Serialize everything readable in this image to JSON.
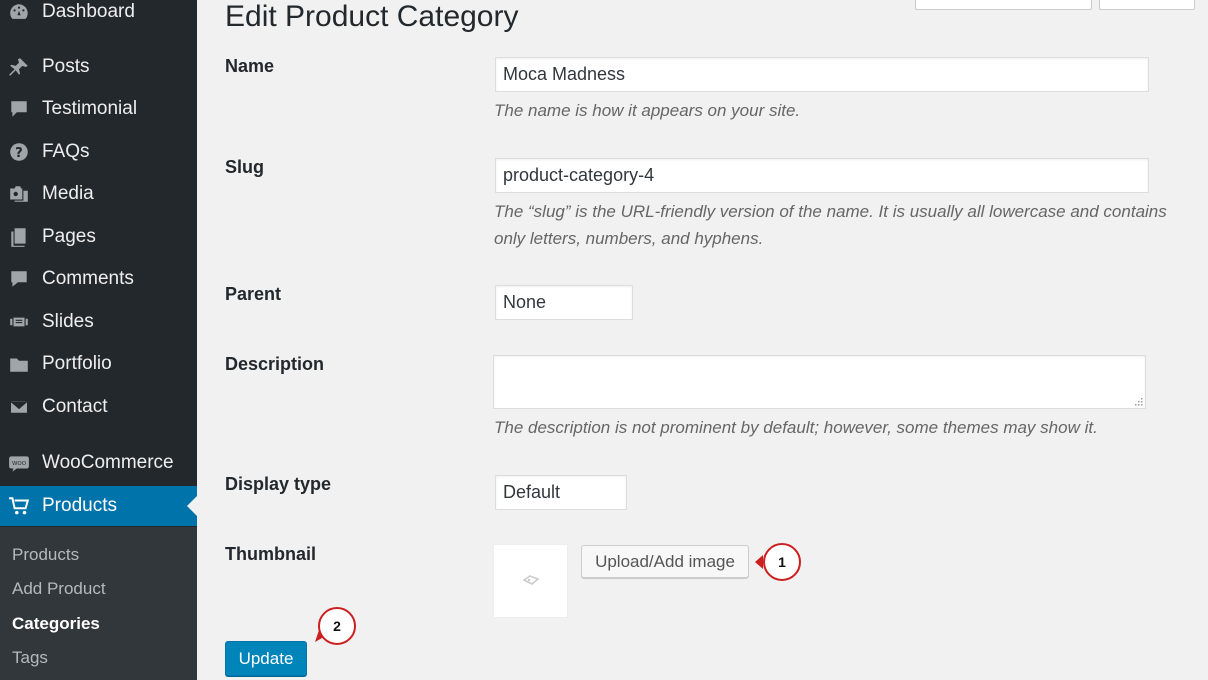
{
  "sidebar": {
    "items": [
      {
        "label": "Dashboard",
        "icon": "dashboard-icon"
      },
      {
        "label": "Posts",
        "icon": "pin-icon"
      },
      {
        "label": "Testimonial",
        "icon": "comment-list-icon"
      },
      {
        "label": "FAQs",
        "icon": "question-icon"
      },
      {
        "label": "Media",
        "icon": "media-icon"
      },
      {
        "label": "Pages",
        "icon": "pages-icon"
      },
      {
        "label": "Comments",
        "icon": "comment-icon"
      },
      {
        "label": "Slides",
        "icon": "slides-icon"
      },
      {
        "label": "Portfolio",
        "icon": "folder-icon"
      },
      {
        "label": "Contact",
        "icon": "envelope-icon"
      },
      {
        "label": "WooCommerce",
        "icon": "woo-icon"
      },
      {
        "label": "Products",
        "icon": "cart-icon"
      }
    ],
    "submenu": [
      "Products",
      "Add Product",
      "Categories",
      "Tags"
    ],
    "current_submenu": "Categories"
  },
  "page": {
    "title": "Edit Product Category"
  },
  "form": {
    "name": {
      "label": "Name",
      "value": "Moca Madness",
      "description": "The name is how it appears on your site."
    },
    "slug": {
      "label": "Slug",
      "value": "product-category-4",
      "description_line1": "The “slug” is the URL-friendly version of the name. It is usually all lowercase and contains",
      "description_line2": "only letters, numbers, and hyphens."
    },
    "parent": {
      "label": "Parent",
      "value": "None"
    },
    "description": {
      "label": "Description",
      "value": "",
      "description": "The description is not prominent by default; however, some themes may show it."
    },
    "display_type": {
      "label": "Display type",
      "value": "Default"
    },
    "thumbnail": {
      "label": "Thumbnail",
      "upload_label": "Upload/Add image"
    },
    "update_label": "Update"
  },
  "callouts": [
    "1",
    "2"
  ],
  "colors": {
    "sidebar": "#23282d",
    "active": "#0073aa",
    "button_primary": "#0085ba",
    "callout": "#cc1f1f"
  }
}
